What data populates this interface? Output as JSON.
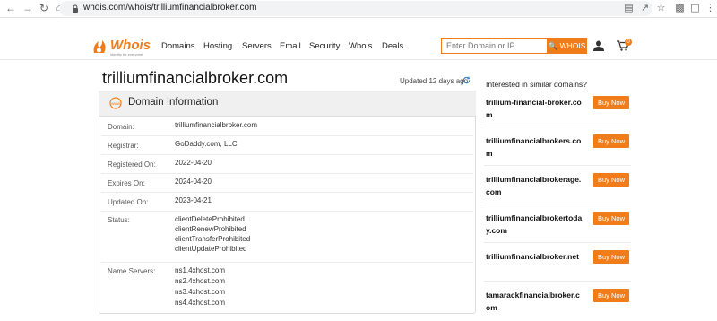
{
  "browser": {
    "url": "whois.com/whois/trilliumfinancialbroker.com"
  },
  "site": {
    "logo_text": "Whois",
    "logo_tagline": "Identity for everyone",
    "menu": [
      "Domains",
      "Hosting",
      "Servers",
      "Email",
      "Security",
      "Whois",
      "Deals"
    ],
    "search_placeholder": "Enter Domain or IP",
    "search_button": "WHOIS",
    "cart_count": "0",
    "accent_color": "#f07d1a"
  },
  "main": {
    "domain_title": "trilliumfinancialbroker.com",
    "updated_text": "Updated 12 days ago",
    "card_title": "Domain Information",
    "rows": [
      {
        "label": "Domain:",
        "values": [
          "trilliumfinancialbroker.com"
        ]
      },
      {
        "label": "Registrar:",
        "values": [
          "GoDaddy.com, LLC"
        ]
      },
      {
        "label": "Registered On:",
        "values": [
          "2022-04-20"
        ]
      },
      {
        "label": "Expires On:",
        "values": [
          "2024-04-20"
        ]
      },
      {
        "label": "Updated On:",
        "values": [
          "2023-04-21"
        ]
      },
      {
        "label": "Status:",
        "values": [
          "clientDeleteProhibited",
          "clientRenewProhibited",
          "clientTransferProhibited",
          "clientUpdateProhibited"
        ]
      },
      {
        "label": "Name Servers:",
        "values": [
          "ns1.4xhost.com",
          "ns2.4xhost.com",
          "ns3.4xhost.com",
          "ns4.4xhost.com"
        ]
      }
    ]
  },
  "sidebar": {
    "title": "Interested in similar domains?",
    "buy_label": "Buy Now",
    "suggestions": [
      "trillium-financial-broker.com",
      "trilliumfinancialbrokers.com",
      "trilliumfinancialbrokerage.com",
      "trilliumfinancialbrokertoday.com",
      "trilliumfinancialbroker.net",
      "tamarackfinancialbroker.com"
    ]
  }
}
